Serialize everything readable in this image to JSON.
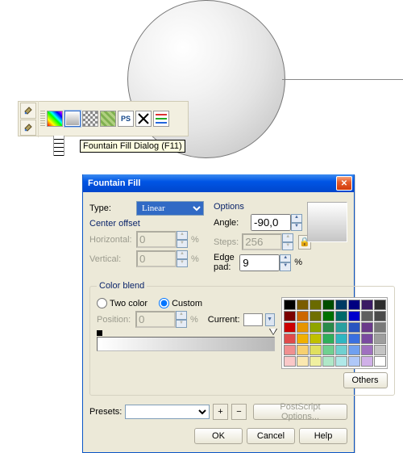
{
  "toolbar": {
    "tooltip": "Fountain Fill Dialog (F11)",
    "ps_label": "PS"
  },
  "dialog": {
    "title": "Fountain Fill",
    "type_label": "Type:",
    "type_value": "Linear",
    "center_offset_title": "Center offset",
    "horizontal_label": "Horizontal:",
    "horizontal_value": "0",
    "vertical_label": "Vertical:",
    "vertical_value": "0",
    "options_title": "Options",
    "angle_label": "Angle:",
    "angle_value": "-90,0",
    "steps_label": "Steps:",
    "steps_value": "256",
    "edgepad_label": "Edge pad:",
    "edgepad_value": "9",
    "pct": "%",
    "colorblend_title": "Color blend",
    "two_color_label": "Two color",
    "custom_label": "Custom",
    "position_label": "Position:",
    "position_value": "0",
    "current_label": "Current:",
    "others_label": "Others",
    "presets_label": "Presets:",
    "presets_value": "",
    "postscript_label": "PostScript Options...",
    "ok": "OK",
    "cancel": "Cancel",
    "help": "Help",
    "plus": "+",
    "minus": "−"
  },
  "palette": [
    "#000000",
    "#7a5c00",
    "#6a6a00",
    "#004d00",
    "#003a63",
    "#000080",
    "#3a1a63",
    "#2e2e2e",
    "#7a0000",
    "#cc6600",
    "#6f6f00",
    "#007000",
    "#006a6a",
    "#0000cc",
    "#5e5e5e",
    "#4a4a4a",
    "#cc0000",
    "#e69500",
    "#8fa500",
    "#2a8a4a",
    "#2aa0a0",
    "#2a55c0",
    "#6a3a8a",
    "#7a7a7a",
    "#e04a4a",
    "#f0b000",
    "#c0c000",
    "#2fae5a",
    "#2fb6c2",
    "#3a6fe0",
    "#7a4aa0",
    "#9e9e9e",
    "#f09090",
    "#f7d070",
    "#e0e060",
    "#70d090",
    "#70d0d0",
    "#70a0f0",
    "#a070c0",
    "#c4c4c4",
    "#fac8c8",
    "#fbe8b0",
    "#f0f0a0",
    "#b0e8c8",
    "#b0e8e8",
    "#b0c8f8",
    "#d0b0e8",
    "#ffffff"
  ]
}
